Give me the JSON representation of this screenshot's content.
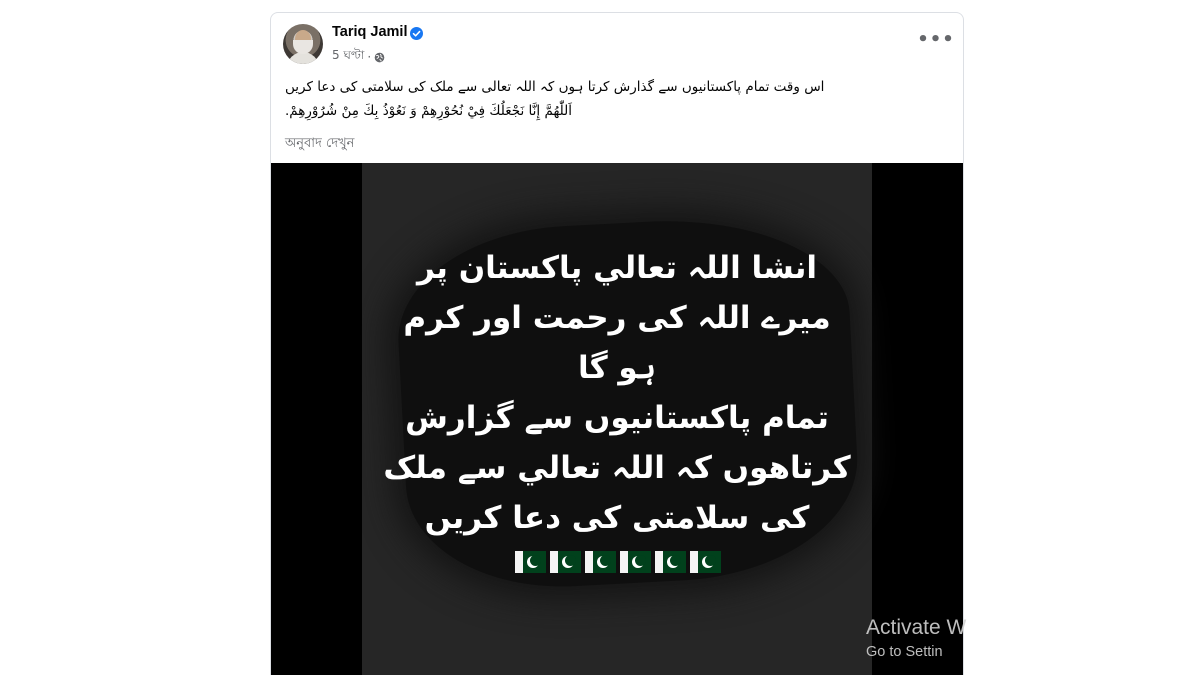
{
  "post": {
    "author": "Tariq Jamil",
    "time": "5 ঘণ্টা",
    "more_label": "•••",
    "text_lines": [
      "اس وقت تمام  پاکستانیوں سے گذارش کرتا ہوں کہ اللہ تعالی سے ملک کی سلامتی کی دعا کریں",
      "اَللّٰهُمَّ إِنَّا نَجْعَلُكَ فِيْ نُحُوْرِهِمْ وَ نَعُوْذُ بِكَ مِنْ شُرُوْرِهِمْ."
    ],
    "translate_link": "অনুবাদ দেখুন",
    "icons": {
      "verified": "verified-badge-icon",
      "privacy": "globe-icon"
    }
  },
  "media": {
    "overlay_lines": [
      "انشا اللہ تعالي پاکستان پر",
      "میرے اللہ کی رحمت اور کرم",
      "ہو گا",
      "تمام پاکستانیوں سے گزارش",
      "کرتاهوں کہ اللہ تعالي سے ملک",
      "کی سلامتی کی دعا کریں"
    ],
    "flags": [
      "pakistan-flag",
      "pakistan-flag",
      "pakistan-flag",
      "pakistan-flag",
      "pakistan-flag",
      "pakistan-flag"
    ]
  },
  "watermark": {
    "title": "Activate W",
    "subtitle": "Go to Settin"
  },
  "colors": {
    "verified": "#1877f2",
    "secondary_text": "#65676b",
    "flag_green": "#01411c"
  }
}
